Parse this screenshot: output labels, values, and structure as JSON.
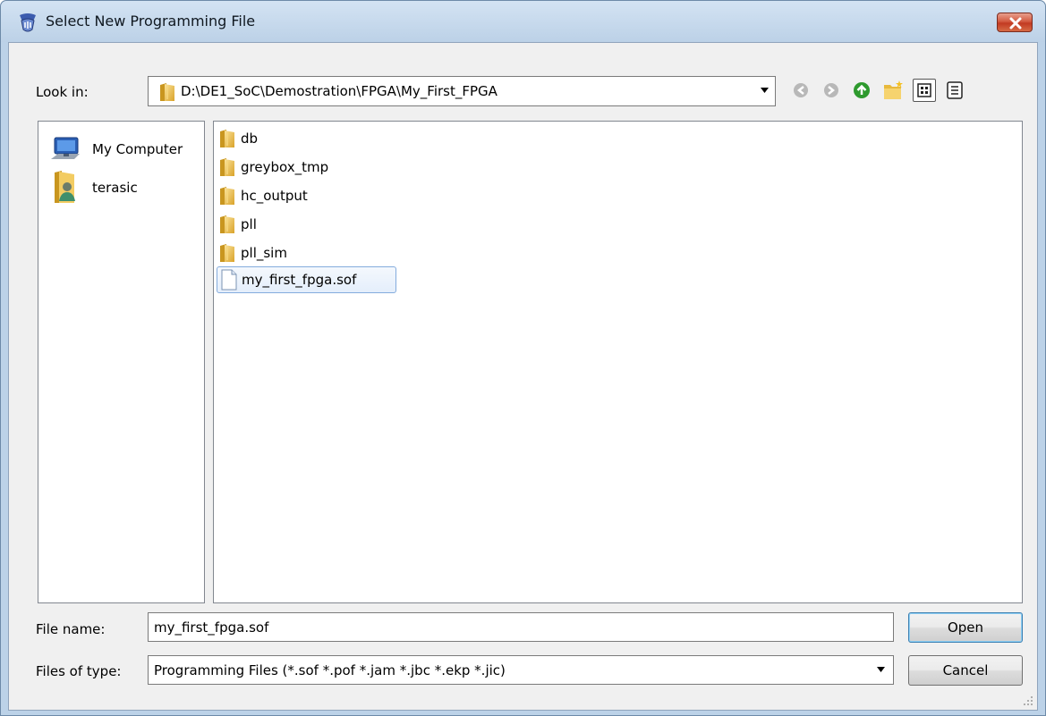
{
  "window": {
    "title": "Select New Programming File",
    "close_icon": "close-icon",
    "close_color": "#c7472c"
  },
  "look_in": {
    "label": "Look in:",
    "path": "D:\\DE1_SoC\\Demostration\\FPGA\\My_First_FPGA"
  },
  "toolbar": {
    "buttons": [
      "back-icon",
      "forward-icon",
      "up-folder-icon",
      "new-folder-icon",
      "list-view-icon",
      "detail-view-icon"
    ]
  },
  "sidebar": {
    "items": [
      {
        "label": "My Computer",
        "icon": "computer-icon"
      },
      {
        "label": "terasic",
        "icon": "user-folder-icon"
      }
    ]
  },
  "files": {
    "items": [
      {
        "name": "db",
        "type": "folder"
      },
      {
        "name": "greybox_tmp",
        "type": "folder"
      },
      {
        "name": "hc_output",
        "type": "folder"
      },
      {
        "name": "pll",
        "type": "folder"
      },
      {
        "name": "pll_sim",
        "type": "folder"
      },
      {
        "name": "my_first_fpga.sof",
        "type": "file",
        "selected": true
      }
    ]
  },
  "file_name": {
    "label": "File name:",
    "value": "my_first_fpga.sof"
  },
  "file_type": {
    "label": "Files of type:",
    "value": "Programming Files (*.sof *.pof *.jam *.jbc *.ekp *.jic)"
  },
  "buttons": {
    "open": "Open",
    "cancel": "Cancel"
  },
  "colors": {
    "folder": "#e8b93c",
    "selection_border": "#84acdd",
    "nav_green": "#2e9a2e"
  }
}
